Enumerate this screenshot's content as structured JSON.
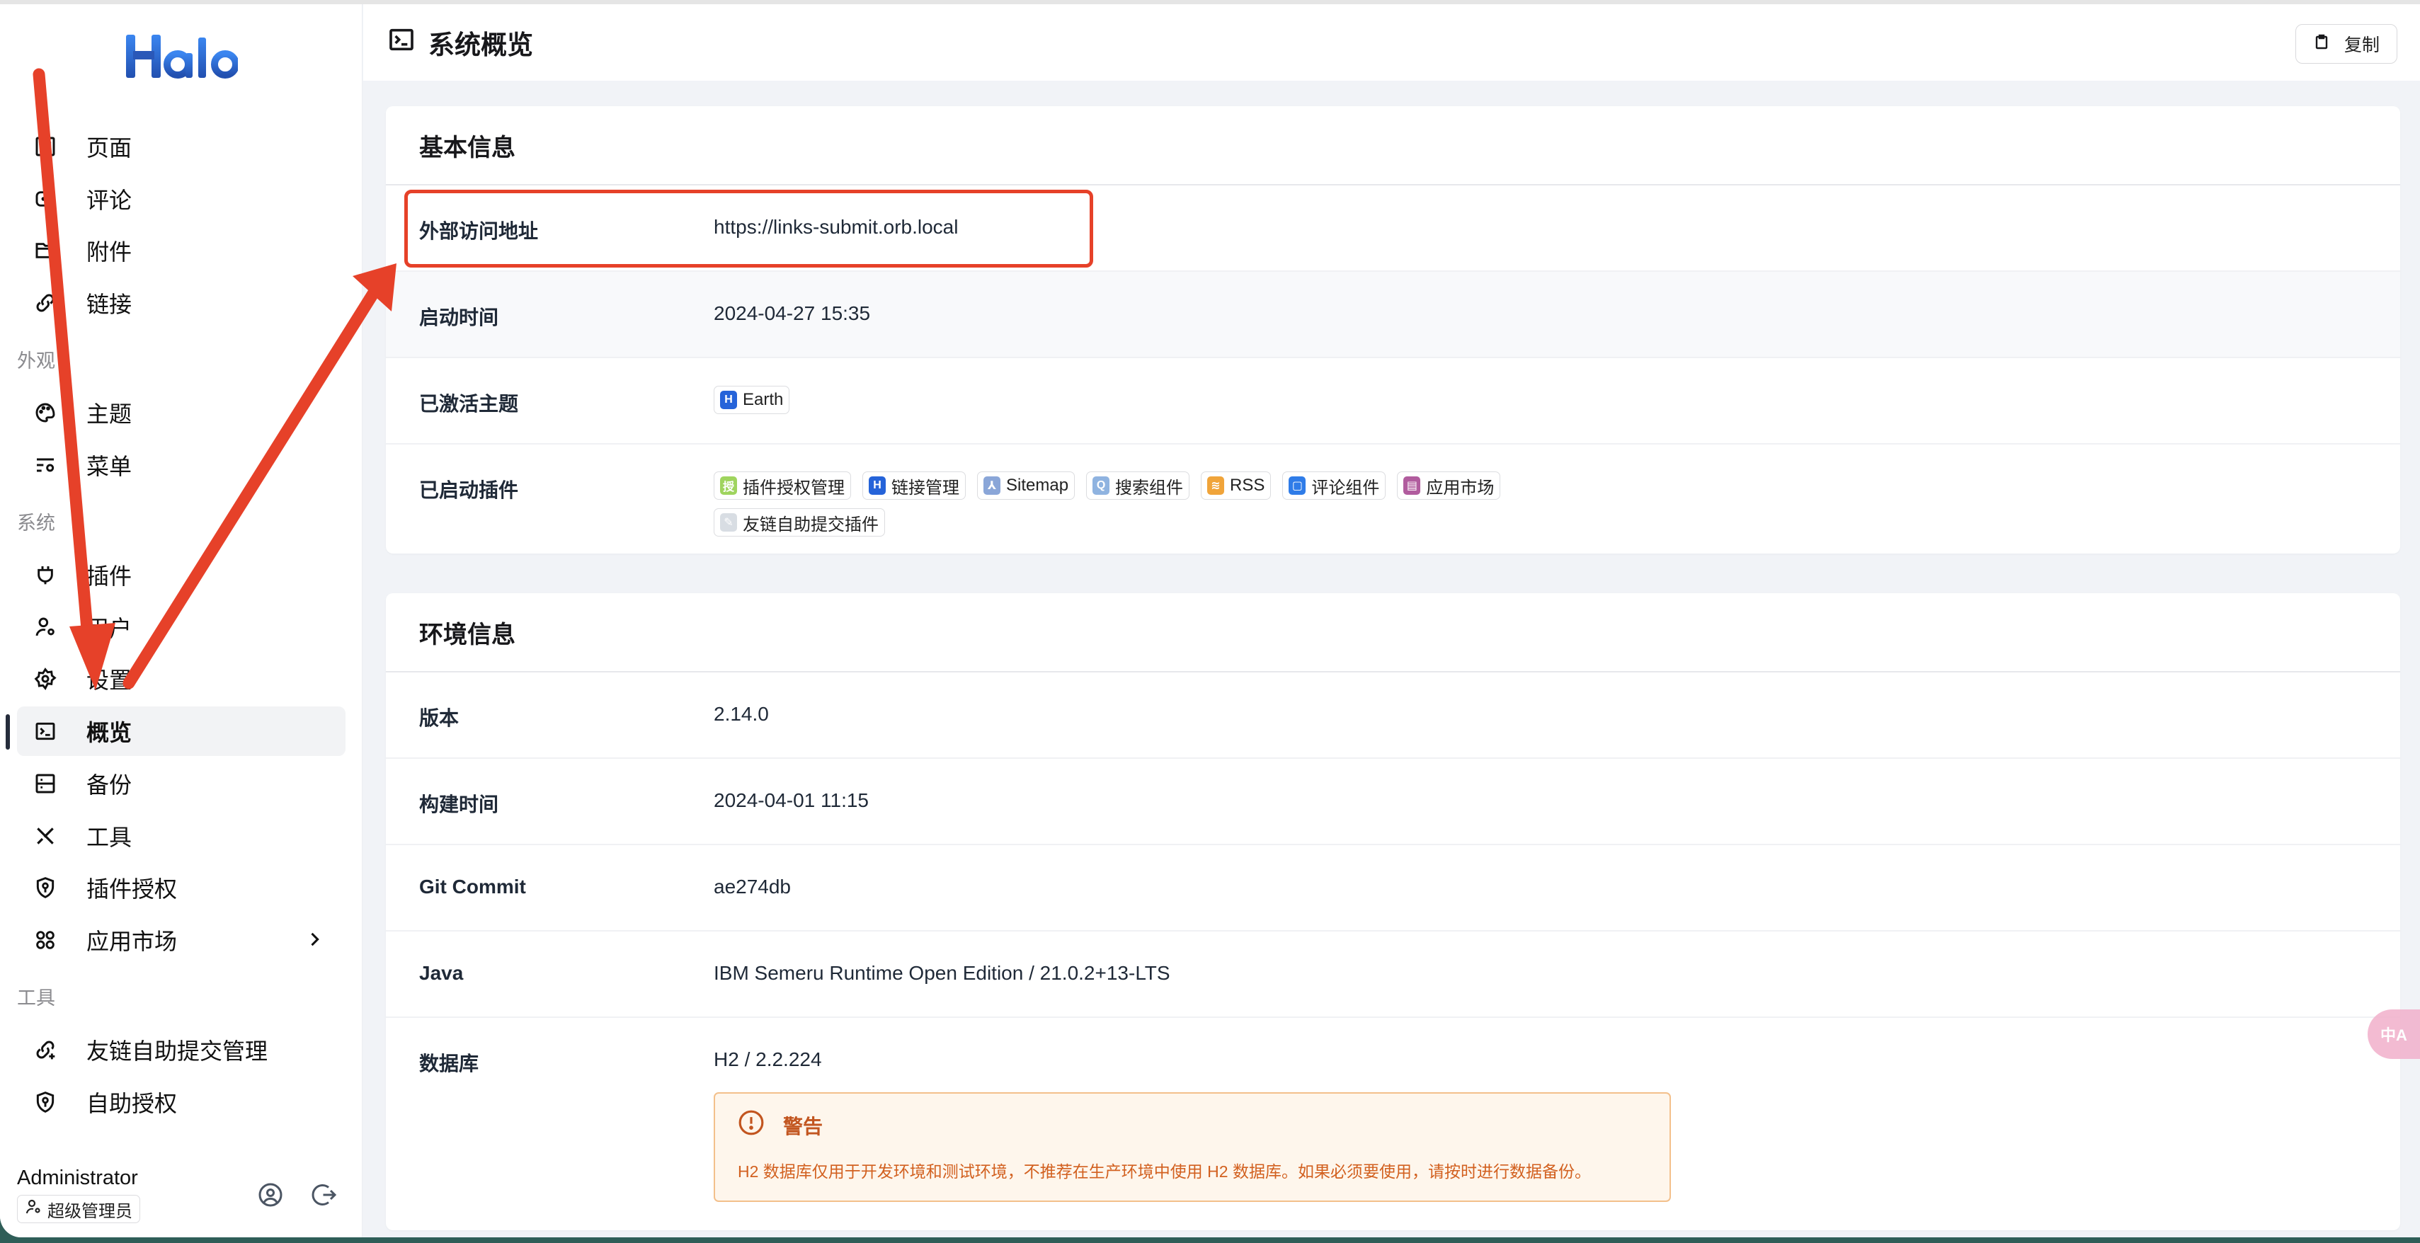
{
  "app": {
    "logo_text": "Halo",
    "brand_color": "#2563d9"
  },
  "sidebar": {
    "items_top": [
      {
        "label": "页面",
        "icon": "page-icon"
      },
      {
        "label": "评论",
        "icon": "comment-icon"
      },
      {
        "label": "附件",
        "icon": "folder-icon"
      },
      {
        "label": "链接",
        "icon": "link-icon"
      }
    ],
    "group_appearance": "外观",
    "items_appearance": [
      {
        "label": "主题",
        "icon": "palette-icon"
      },
      {
        "label": "菜单",
        "icon": "menu-settings-icon"
      }
    ],
    "group_system": "系统",
    "items_system": [
      {
        "label": "插件",
        "icon": "plug-icon"
      },
      {
        "label": "用户",
        "icon": "user-settings-icon"
      },
      {
        "label": "设置",
        "icon": "gear-icon"
      },
      {
        "label": "概览",
        "icon": "terminal-icon",
        "active": true
      },
      {
        "label": "备份",
        "icon": "database-icon"
      },
      {
        "label": "工具",
        "icon": "tools-icon"
      },
      {
        "label": "插件授权",
        "icon": "shield-key-icon"
      },
      {
        "label": "应用市场",
        "icon": "apps-icon",
        "has_submenu": true
      }
    ],
    "group_tools": "工具",
    "items_tools": [
      {
        "label": "友链自助提交管理",
        "icon": "link-add-icon"
      },
      {
        "label": "自助授权",
        "icon": "shield-key-icon"
      }
    ],
    "user": {
      "name": "Administrator",
      "role": "超级管理员"
    }
  },
  "header": {
    "title": "系统概览",
    "copy_label": "复制"
  },
  "basic_info": {
    "title": "基本信息",
    "external_url": {
      "label": "外部访问地址",
      "value": "https://links-submit.orb.local"
    },
    "start_time": {
      "label": "启动时间",
      "value": "2024-04-27 15:35"
    },
    "active_theme": {
      "label": "已激活主题",
      "value": "Earth"
    },
    "plugins": {
      "label": "已启动插件",
      "items": [
        {
          "name": "插件授权管理",
          "icon_text": "授",
          "color": "#9fd45e"
        },
        {
          "name": "链接管理",
          "icon_text": "H",
          "color": "#2563d9"
        },
        {
          "name": "Sitemap",
          "icon_text": "⅄",
          "color": "#8aa6d8"
        },
        {
          "name": "搜索组件",
          "icon_text": "Q",
          "color": "#8fb3e0"
        },
        {
          "name": "RSS",
          "icon_text": "≋",
          "color": "#f0a43a"
        },
        {
          "name": "评论组件",
          "icon_text": "▢",
          "color": "#2f7ce8"
        },
        {
          "name": "应用市场",
          "icon_text": "▤",
          "color": "#b15c9e"
        },
        {
          "name": "友链自助提交插件",
          "icon_text": "✎",
          "color": "#d8dde3"
        }
      ]
    }
  },
  "env_info": {
    "title": "环境信息",
    "version": {
      "label": "版本",
      "value": "2.14.0"
    },
    "build_time": {
      "label": "构建时间",
      "value": "2024-04-01 11:15"
    },
    "git_commit": {
      "label": "Git Commit",
      "value": "ae274db"
    },
    "java": {
      "label": "Java",
      "value": "IBM Semeru Runtime Open Edition / 21.0.2+13-LTS"
    },
    "database": {
      "label": "数据库",
      "value": "H2 / 2.2.224"
    },
    "warning": {
      "title": "警告",
      "message": "H2 数据库仅用于开发环境和测试环境，不推荐在生产环境中使用 H2 数据库。如果必须要使用，请按时进行数据备份。"
    }
  },
  "floating": {
    "translate_label": "中A"
  },
  "annotation_color": "#e64129"
}
